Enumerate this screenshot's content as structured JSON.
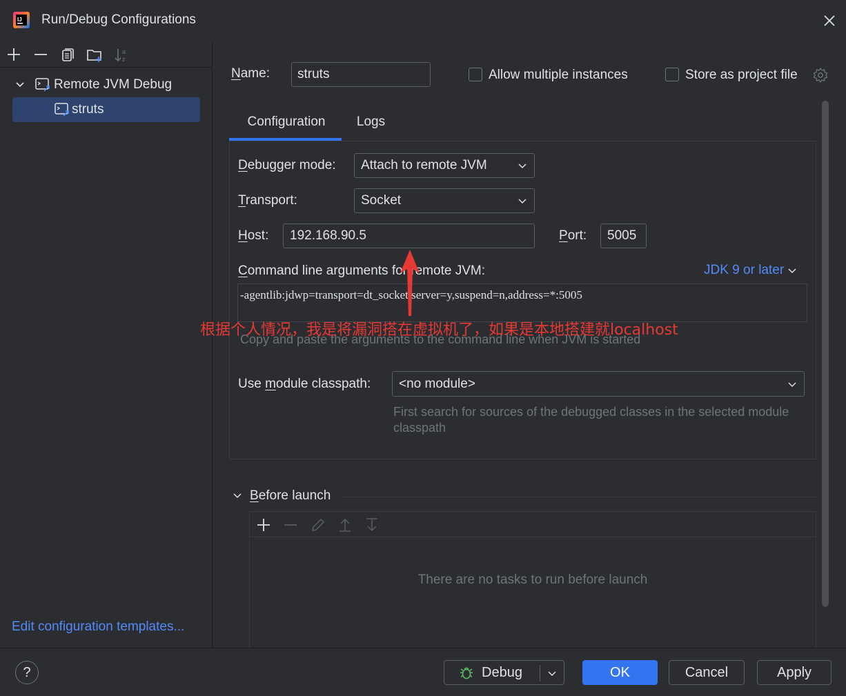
{
  "window": {
    "title": "Run/Debug Configurations"
  },
  "sidebar": {
    "tree": [
      {
        "label": "Remote JVM Debug",
        "expanded": true
      },
      {
        "label": "struts",
        "selected": true
      }
    ],
    "edit_templates_link": "Edit configuration templates..."
  },
  "form": {
    "name_label_first": "N",
    "name_label_rest": "ame:",
    "name_value": "struts",
    "allow_multiple_label": "Allow multiple instances",
    "store_project_label": "Store as project file",
    "tabs": [
      {
        "label": "Configuration",
        "active": true
      },
      {
        "label": "Logs",
        "active": false
      }
    ],
    "debugger_mode_label_first": "D",
    "debugger_mode_label_rest": "ebugger mode:",
    "debugger_mode_value": "Attach to remote JVM",
    "transport_label_first": "T",
    "transport_label_rest": "ransport:",
    "transport_value": "Socket",
    "host_label_first": "H",
    "host_label_rest": "ost:",
    "host_value": "192.168.90.5",
    "port_label_first": "P",
    "port_label_rest": "ort:",
    "port_value": "5005",
    "cmd_label_first": "C",
    "cmd_label_rest": "ommand line arguments for remote JVM:",
    "jdk_link": "JDK 9 or later",
    "cmd_value": "-agentlib:jdwp=transport=dt_socket,server=y,suspend=n,address=*:5005",
    "cmd_hint": "Copy and paste the arguments to the command line when JVM is started",
    "module_label_pre": "Use ",
    "module_label_first": "m",
    "module_label_rest": "odule classpath:",
    "module_value": "<no module>",
    "module_hint": "First search for sources of the debugged classes in the selected module classpath"
  },
  "annotation": {
    "text": "根据个人情况，我是将漏洞搭在虚拟机了，如果是本地搭建就localhost",
    "color": "#e53935"
  },
  "before_launch": {
    "title_first": "B",
    "title_rest": "efore launch",
    "empty_text": "There are no tasks to run before launch"
  },
  "buttons": {
    "help": "?",
    "debug": "Debug",
    "ok": "OK",
    "cancel": "Cancel",
    "apply": "Apply"
  },
  "colors": {
    "background": "#2b2d30",
    "accent": "#3574f0",
    "link": "#548af7",
    "selection": "#2e436e"
  }
}
